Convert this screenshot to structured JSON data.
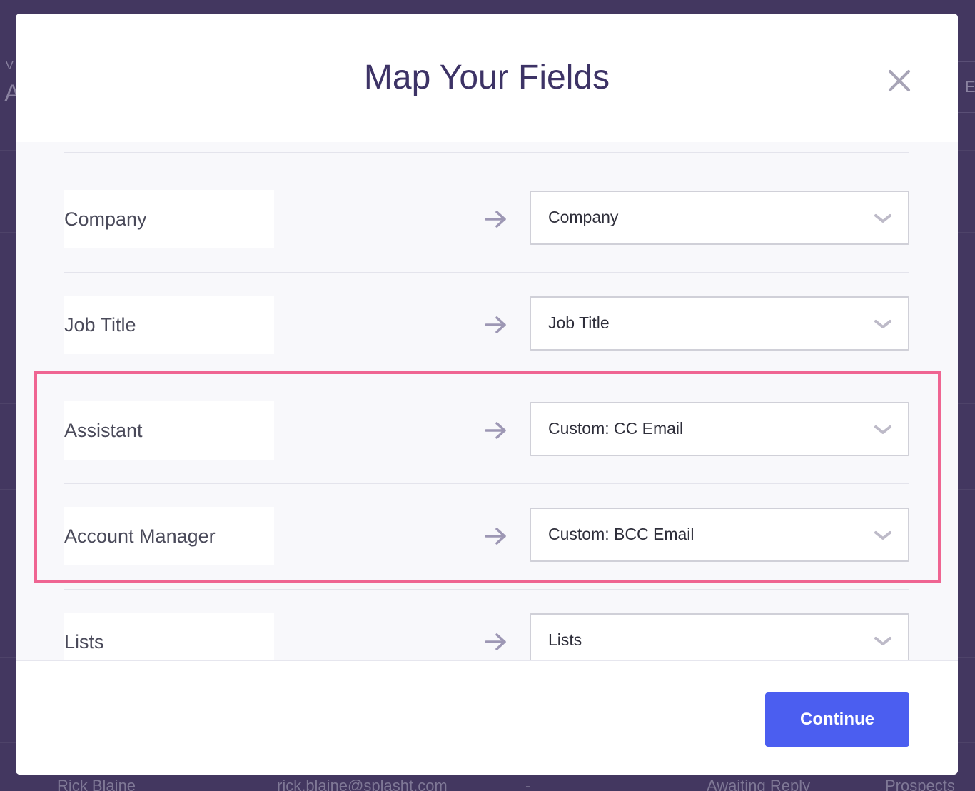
{
  "background": {
    "left_partial_small": "V",
    "left_partial_large": "A",
    "right_partial": "E",
    "bottom_row": {
      "name": "Rick Blaine",
      "email": "rick.blaine@splasht.com",
      "dash": "-",
      "status": "Awaiting Reply",
      "list": "Prospects"
    }
  },
  "modal": {
    "title": "Map Your Fields",
    "close_icon": "close-icon",
    "rows": [
      {
        "source": "Company",
        "target": "Company"
      },
      {
        "source": "Job Title",
        "target": "Job Title"
      },
      {
        "source": "Assistant",
        "target": "Custom: CC Email"
      },
      {
        "source": "Account Manager",
        "target": "Custom: BCC Email"
      },
      {
        "source": "Lists",
        "target": "Lists"
      }
    ],
    "continue_label": "Continue"
  },
  "colors": {
    "overlay": "#433760",
    "title": "#3d3366",
    "accent": "#4b5ef0",
    "highlight": "#ef6592"
  }
}
